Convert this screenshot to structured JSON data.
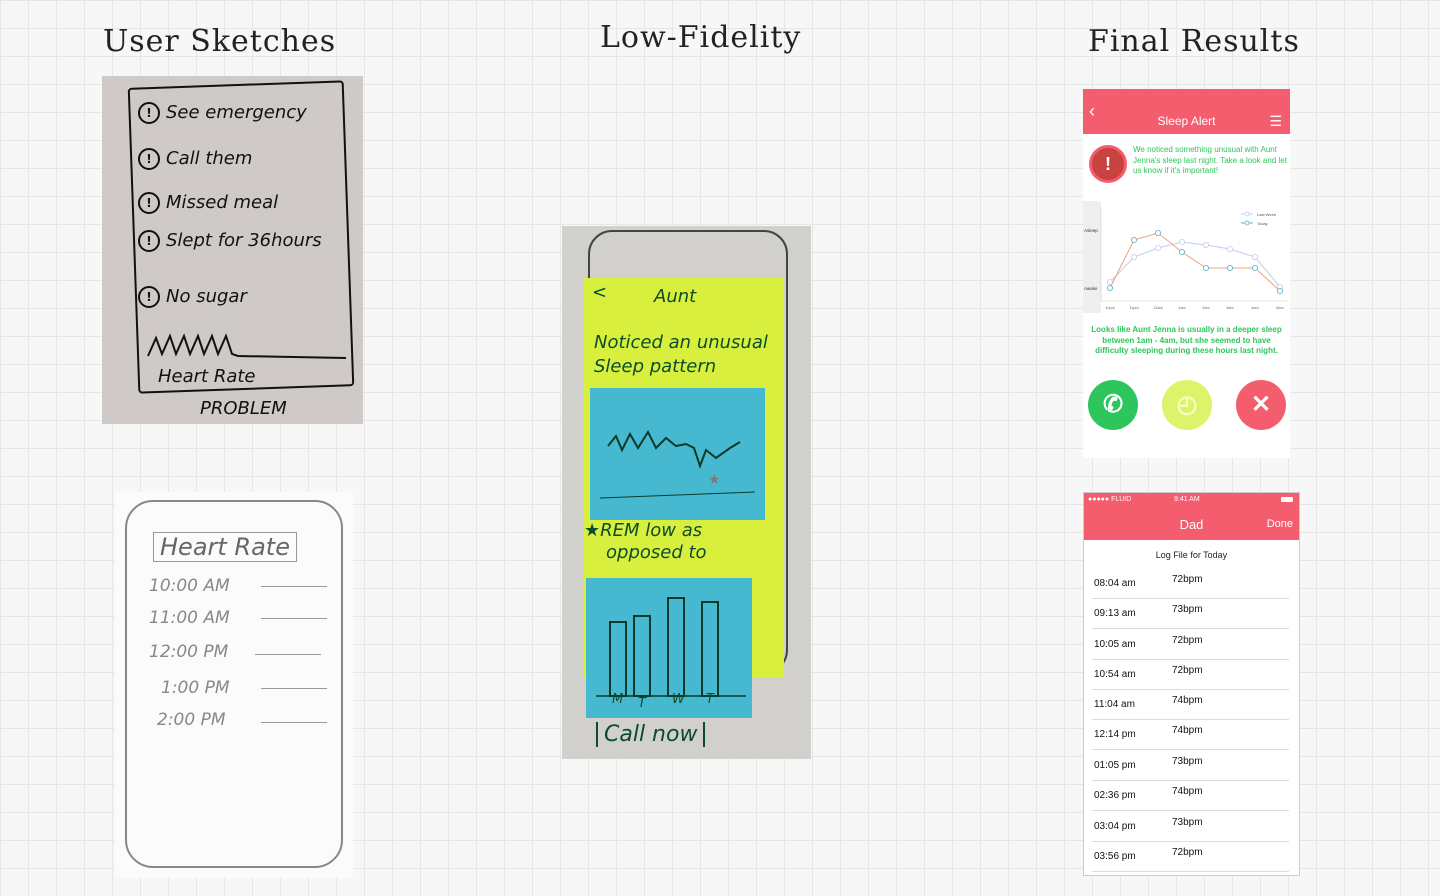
{
  "headings": {
    "sketches": "User Sketches",
    "low_fidelity": "Low-Fidelity",
    "final": "Final Results"
  },
  "sketch1": {
    "items": [
      "See emergency",
      "Call them",
      "Missed meal",
      "Slept for 36hours",
      "No sugar"
    ],
    "heart_rate": "Heart Rate",
    "problem": "PROBLEM"
  },
  "sketch2": {
    "title": "Heart Rate",
    "times": [
      "10:00 AM",
      "11:00 AM",
      "12:00 PM",
      "1:00 PM",
      "2:00 PM"
    ]
  },
  "lowfi": {
    "back": "<",
    "name": "Aunt",
    "line1": "Noticed an unusual",
    "line2": "Sleep pattern",
    "rem1": "★REM low as",
    "rem2": "opposed to",
    "days": [
      "M",
      "T",
      "W",
      "T"
    ],
    "cta": "Call now"
  },
  "final1": {
    "header_title": "Sleep Alert",
    "message": "We noticed something unusual with Aunt Jenna's sleep last night. Take a look and let us know if it's important!",
    "legend": [
      "Last Week",
      "Today"
    ],
    "y_labels": [
      "Asleep",
      "Awake"
    ],
    "x_labels": [
      "10pm",
      "11pm",
      "12am",
      "1am",
      "2am",
      "3am",
      "4am",
      "5am"
    ],
    "note": "Looks like Aunt Jenna is usually in a deeper sleep between 1am - 4am, but she seemed to have difficulty sleeping during these hours last night.",
    "colors": {
      "accent": "#f45d6e",
      "green": "#2ec65c",
      "lime": "#dff36a",
      "series_today": "#5fb8c9",
      "series_last_week": "#c3cde8",
      "series_today_line": "#f2a07a"
    }
  },
  "final2": {
    "status_carrier": "●●●●● FLUID",
    "status_time": "9:41 AM",
    "nav_title": "Dad",
    "nav_done": "Done",
    "log_title": "Log File for Today",
    "rows": [
      {
        "time": "08:04 am",
        "bpm": "72bpm"
      },
      {
        "time": "09:13 am",
        "bpm": "73bpm"
      },
      {
        "time": "10:05 am",
        "bpm": "72bpm"
      },
      {
        "time": "10:54 am",
        "bpm": "72bpm"
      },
      {
        "time": "11:04 am",
        "bpm": "74bpm"
      },
      {
        "time": "12:14 pm",
        "bpm": "74bpm"
      },
      {
        "time": "01:05 pm",
        "bpm": "73bpm"
      },
      {
        "time": "02:36 pm",
        "bpm": "74bpm"
      },
      {
        "time": "03:04 pm",
        "bpm": "73bpm"
      },
      {
        "time": "03:56 pm",
        "bpm": "72bpm"
      }
    ]
  }
}
